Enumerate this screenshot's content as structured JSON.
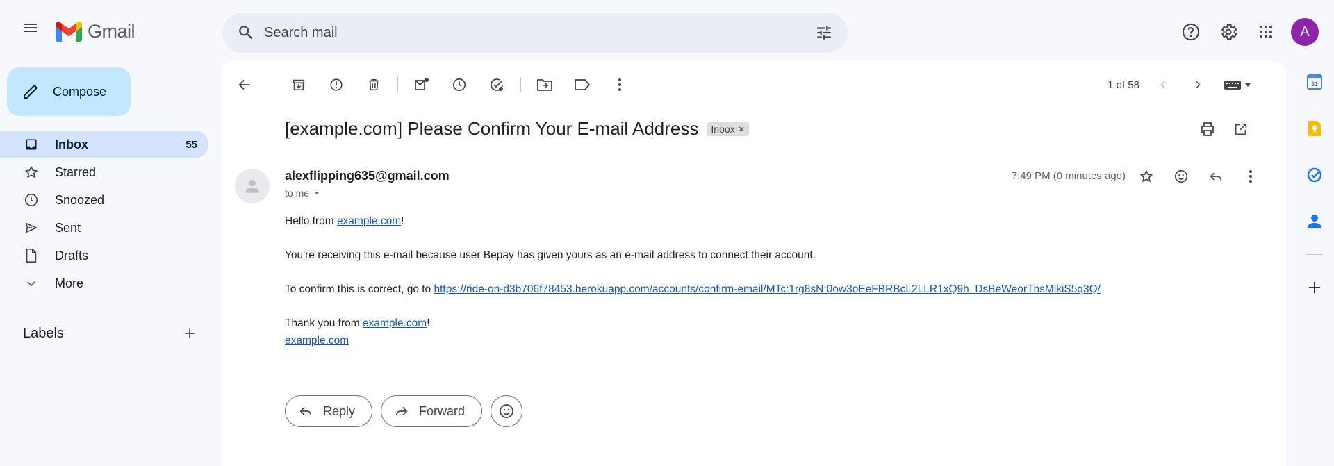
{
  "app": {
    "name": "Gmail"
  },
  "search": {
    "placeholder": "Search mail"
  },
  "account": {
    "avatar_letter": "A",
    "avatar_color": "#8e24aa"
  },
  "compose": {
    "label": "Compose"
  },
  "nav": {
    "items": [
      {
        "label": "Inbox",
        "count": "55",
        "icon": "inbox-icon"
      },
      {
        "label": "Starred",
        "icon": "star-icon"
      },
      {
        "label": "Snoozed",
        "icon": "clock-icon"
      },
      {
        "label": "Sent",
        "icon": "send-icon"
      },
      {
        "label": "Drafts",
        "icon": "draft-icon"
      },
      {
        "label": "More",
        "icon": "chevron-down-icon"
      }
    ],
    "labels_title": "Labels"
  },
  "pager": {
    "text": "1 of 58"
  },
  "email": {
    "subject": "[example.com] Please Confirm Your E-mail Address",
    "label_chip": "Inbox",
    "sender": "alexflipping635@gmail.com",
    "to": "to me",
    "time": "7:49 PM (0 minutes ago)",
    "body": {
      "greeting_prefix": "Hello from ",
      "greeting_link": "example.com",
      "greeting_suffix": "!",
      "line2": "You're receiving this e-mail because user Bepay has given yours as an e-mail address to connect their account.",
      "line3_prefix": "To confirm this is correct, go to ",
      "line3_link": "https://ride-on-d3b706f78453.herokuapp.com/accounts/confirm-email/MTc:1rg8sN:0ow3oEeFBRBcL2LLR1xQ9h_DsBeWeorTnsMlkiS5q3Q/",
      "thanks_prefix": "Thank you from ",
      "thanks_link": "example.com",
      "thanks_suffix": "!",
      "signature_link": "example.com"
    }
  },
  "actions": {
    "reply": "Reply",
    "forward": "Forward"
  },
  "colors": {
    "accent": "#0b57d0",
    "compose_bg": "#c2e7ff",
    "active_nav": "#d3e3fd",
    "link": "#1155cc"
  }
}
